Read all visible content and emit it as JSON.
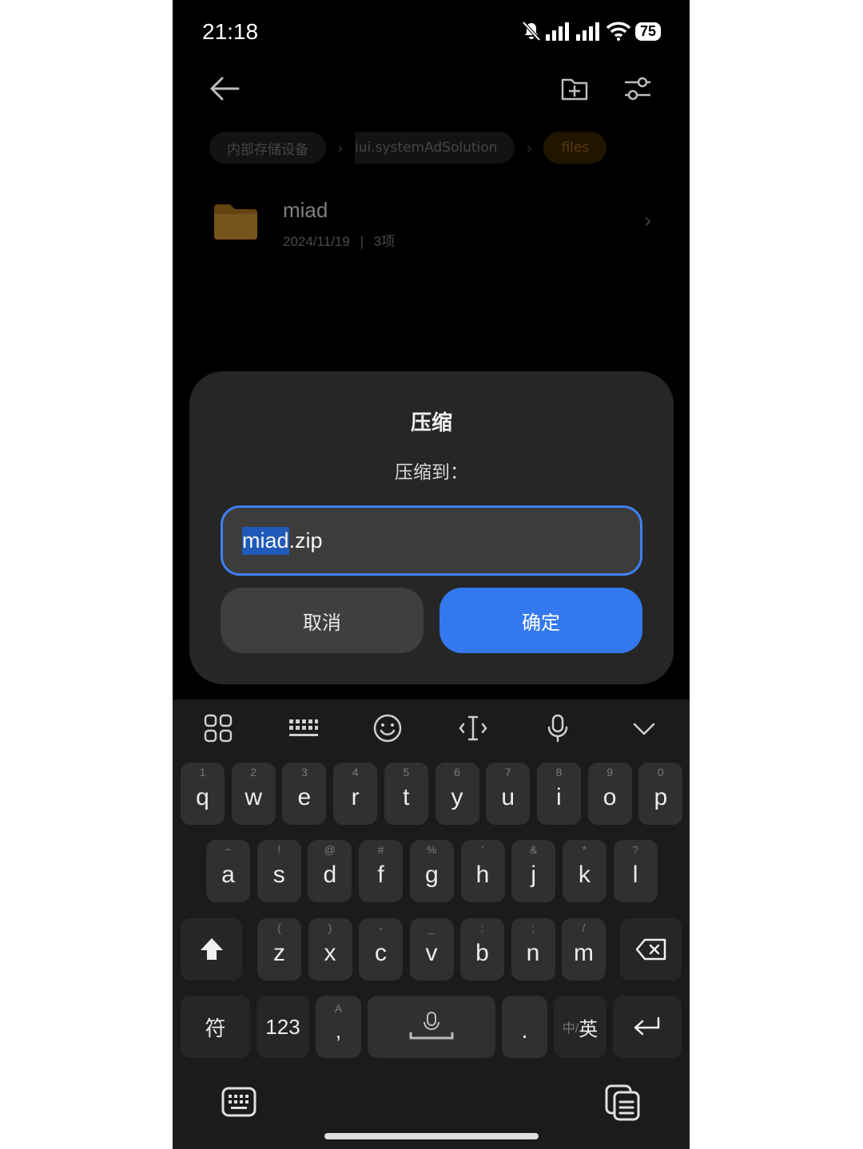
{
  "status_bar": {
    "time": "21:18",
    "battery": "75"
  },
  "breadcrumbs": [
    {
      "label": "内部存储设备",
      "active": false
    },
    {
      "label": "iui.systemAdSolution",
      "active": false
    },
    {
      "label": "files",
      "active": true
    }
  ],
  "file_row": {
    "name": "miad",
    "date": "2024/11/19",
    "separator": "|",
    "count": "3项"
  },
  "dialog": {
    "title": "压缩",
    "label": "压缩到：",
    "input_selected": "miad",
    "input_rest": ".zip",
    "cancel_label": "取消",
    "ok_label": "确定"
  },
  "keyboard": {
    "row1": [
      {
        "k": "q",
        "h": "1"
      },
      {
        "k": "w",
        "h": "2"
      },
      {
        "k": "e",
        "h": "3"
      },
      {
        "k": "r",
        "h": "4"
      },
      {
        "k": "t",
        "h": "5"
      },
      {
        "k": "y",
        "h": "6"
      },
      {
        "k": "u",
        "h": "7"
      },
      {
        "k": "i",
        "h": "8"
      },
      {
        "k": "o",
        "h": "9"
      },
      {
        "k": "p",
        "h": "0"
      }
    ],
    "row2": [
      {
        "k": "a",
        "h": "~"
      },
      {
        "k": "s",
        "h": "!"
      },
      {
        "k": "d",
        "h": "@"
      },
      {
        "k": "f",
        "h": "#"
      },
      {
        "k": "g",
        "h": "%"
      },
      {
        "k": "h",
        "h": "'"
      },
      {
        "k": "j",
        "h": "&"
      },
      {
        "k": "k",
        "h": "*"
      },
      {
        "k": "l",
        "h": "?"
      }
    ],
    "row3": [
      {
        "k": "z",
        "h": "("
      },
      {
        "k": "x",
        "h": ")"
      },
      {
        "k": "c",
        "h": "-"
      },
      {
        "k": "v",
        "h": "_"
      },
      {
        "k": "b",
        "h": ":"
      },
      {
        "k": "n",
        "h": ";"
      },
      {
        "k": "m",
        "h": "/"
      }
    ],
    "symbols_label": "符",
    "numbers_label": "123",
    "comma_label": ",",
    "comma_hint": "A",
    "period_label": ".",
    "lang_inactive": "中/",
    "lang_active": "英"
  },
  "colors": {
    "accent": "#3478f0",
    "folder": "#b8791f",
    "dialog_bg": "#262626",
    "keyboard_bg": "#1b1b1b"
  }
}
